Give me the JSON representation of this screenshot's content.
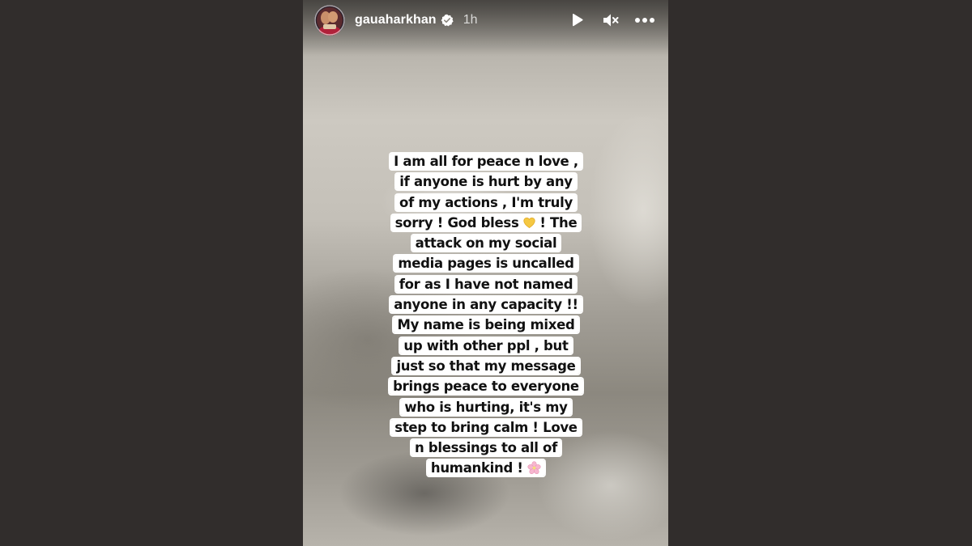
{
  "story": {
    "username": "gauaharkhan",
    "time_ago": "1h",
    "verified": true,
    "icons": {
      "avatar": "profile-avatar",
      "verified": "verified-badge-icon",
      "play": "play-icon",
      "mute": "muted-speaker-icon",
      "more": "more-options-icon"
    },
    "caption_lines": [
      "I am all for peace n love ,",
      "if anyone is hurt by any",
      "of my actions , I'm truly",
      "sorry ! God bless",
      "! The",
      "attack on my social",
      "media pages is uncalled",
      "for as I have not named",
      "anyone in any capacity !!",
      "My name is being mixed",
      "up with other ppl , but",
      "just so that my message",
      "brings peace to everyone",
      "who is hurting, it's my",
      "step to bring calm ! Love",
      "n blessings to all of",
      "humankind !"
    ],
    "emoji": {
      "heart": "yellow-heart",
      "flower": "cherry-blossom"
    }
  },
  "colors": {
    "page_background": "#312d2c",
    "caption_highlight": "#ffffff",
    "caption_text": "#111111",
    "header_text": "#ffffff"
  }
}
